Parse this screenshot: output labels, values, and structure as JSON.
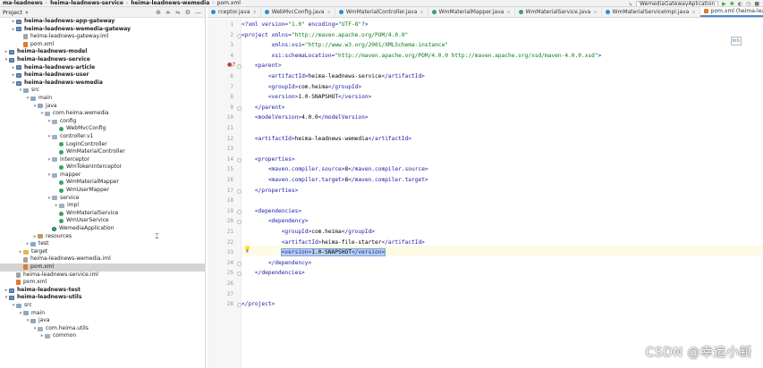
{
  "breadcrumbs": [
    "ma-leadnews",
    "heima-leadnews-service",
    "heima-leadnews-wemedia",
    "pom.xml"
  ],
  "run_config": "WemediaGatewayAplication",
  "project": {
    "title": "Project",
    "tree": [
      {
        "label": "heima-leadnews-app-gateway",
        "indent": 1,
        "icon": "module",
        "arrow": "▸",
        "bold": true
      },
      {
        "label": "heima-leadnews-wemedia-gateway",
        "indent": 1,
        "icon": "module",
        "arrow": "▸",
        "bold": true
      },
      {
        "label": "heima-leadnews-gateway.iml",
        "indent": 2,
        "icon": "iml",
        "arrow": "",
        "bold": false
      },
      {
        "label": "pom.xml",
        "indent": 2,
        "icon": "xml",
        "arrow": "",
        "bold": false
      },
      {
        "label": "heima-leadnews-model",
        "indent": 0,
        "icon": "module",
        "arrow": "▸",
        "bold": true
      },
      {
        "label": "heima-leadnews-service",
        "indent": 0,
        "icon": "module",
        "arrow": "▾",
        "bold": true
      },
      {
        "label": "heima-leadnews-article",
        "indent": 1,
        "icon": "module",
        "arrow": "▸",
        "bold": true
      },
      {
        "label": "heima-leadnews-user",
        "indent": 1,
        "icon": "module",
        "arrow": "▸",
        "bold": true
      },
      {
        "label": "heima-leadnews-wemedia",
        "indent": 1,
        "icon": "module",
        "arrow": "▾",
        "bold": true
      },
      {
        "label": "src",
        "indent": 2,
        "icon": "folder",
        "arrow": "▾",
        "bold": false
      },
      {
        "label": "main",
        "indent": 3,
        "icon": "folder",
        "arrow": "▾",
        "bold": false
      },
      {
        "label": "java",
        "indent": 4,
        "icon": "folder",
        "arrow": "▾",
        "bold": false
      },
      {
        "label": "com.heima.wemedia",
        "indent": 5,
        "icon": "pkg",
        "arrow": "▾",
        "bold": false
      },
      {
        "label": "config",
        "indent": 6,
        "icon": "pkg",
        "arrow": "▾",
        "bold": false
      },
      {
        "label": "WebMvcConfig",
        "indent": 7,
        "icon": "java",
        "arrow": "",
        "bold": false
      },
      {
        "label": "controller.v1",
        "indent": 6,
        "icon": "pkg",
        "arrow": "▾",
        "bold": false
      },
      {
        "label": "LoginController",
        "indent": 7,
        "icon": "java",
        "arrow": "",
        "bold": false
      },
      {
        "label": "WmMaterialController",
        "indent": 7,
        "icon": "java",
        "arrow": "",
        "bold": false
      },
      {
        "label": "interceptor",
        "indent": 6,
        "icon": "pkg",
        "arrow": "▾",
        "bold": false
      },
      {
        "label": "WmTokenInterceptor",
        "indent": 7,
        "icon": "java",
        "arrow": "",
        "bold": false
      },
      {
        "label": "mapper",
        "indent": 6,
        "icon": "pkg",
        "arrow": "▾",
        "bold": false
      },
      {
        "label": "WmMaterialMapper",
        "indent": 7,
        "icon": "java",
        "arrow": "",
        "bold": false
      },
      {
        "label": "WmUserMapper",
        "indent": 7,
        "icon": "java",
        "arrow": "",
        "bold": false
      },
      {
        "label": "service",
        "indent": 6,
        "icon": "pkg",
        "arrow": "▾",
        "bold": false
      },
      {
        "label": "impl",
        "indent": 7,
        "icon": "pkg",
        "arrow": "▸",
        "bold": false
      },
      {
        "label": "WmMaterialService",
        "indent": 7,
        "icon": "java",
        "arrow": "",
        "bold": false
      },
      {
        "label": "WmUserService",
        "indent": 7,
        "icon": "java",
        "arrow": "",
        "bold": false
      },
      {
        "label": "WemediaApplication",
        "indent": 6,
        "icon": "app",
        "arrow": "",
        "bold": false
      },
      {
        "label": "resources",
        "indent": 4,
        "icon": "res",
        "arrow": "▸",
        "bold": false
      },
      {
        "label": "test",
        "indent": 3,
        "icon": "folder",
        "arrow": "▸",
        "bold": false
      },
      {
        "label": "target",
        "indent": 2,
        "icon": "folder-y",
        "arrow": "▸",
        "bold": false
      },
      {
        "label": "heima-leadnews-wemedia.iml",
        "indent": 2,
        "icon": "iml",
        "arrow": "",
        "bold": false
      },
      {
        "label": "pom.xml",
        "indent": 2,
        "icon": "xml",
        "arrow": "",
        "bold": false,
        "selected": true
      },
      {
        "label": "heima-leadnews-service.iml",
        "indent": 1,
        "icon": "iml",
        "arrow": "",
        "bold": false
      },
      {
        "label": "pom.xml",
        "indent": 1,
        "icon": "xml",
        "arrow": "",
        "bold": false
      },
      {
        "label": "heima-leadnews-test",
        "indent": 0,
        "icon": "module",
        "arrow": "▸",
        "bold": true
      },
      {
        "label": "heima-leadnews-utils",
        "indent": 0,
        "icon": "module",
        "arrow": "▾",
        "bold": true
      },
      {
        "label": "src",
        "indent": 1,
        "icon": "folder",
        "arrow": "▾",
        "bold": false
      },
      {
        "label": "main",
        "indent": 2,
        "icon": "folder",
        "arrow": "▾",
        "bold": false
      },
      {
        "label": "java",
        "indent": 3,
        "icon": "folder",
        "arrow": "▾",
        "bold": false
      },
      {
        "label": "com.heima.utils",
        "indent": 4,
        "icon": "pkg",
        "arrow": "▾",
        "bold": false
      },
      {
        "label": "common",
        "indent": 5,
        "icon": "pkg",
        "arrow": "▸",
        "bold": false
      }
    ]
  },
  "tabs": [
    {
      "label": "rceptor.java",
      "icon": "c",
      "active": false
    },
    {
      "label": "WebMvcConfig.java",
      "icon": "c",
      "active": false
    },
    {
      "label": "WmMaterialController.java",
      "icon": "c",
      "active": false
    },
    {
      "label": "WmMaterialMapper.java",
      "icon": "g",
      "active": false
    },
    {
      "label": "WmMaterialService.java",
      "icon": "g",
      "active": false
    },
    {
      "label": "WmMaterialServiceImpl.java",
      "icon": "c",
      "active": false
    },
    {
      "label": "pom.xml (heima-leadnews-wemedia)",
      "icon": "m",
      "active": true
    }
  ],
  "editor": {
    "lines": [
      {
        "n": "1",
        "html": "<span class=\"tag\">&lt;?xml </span><span class=\"attr\">version=</span><span class=\"val\">\"1.0\"</span><span class=\"attr\"> encoding=</span><span class=\"val\">\"UTF-8\"</span><span class=\"tag\">?&gt;</span>",
        "fold": false
      },
      {
        "n": "2",
        "html": "<span class=\"tag\">&lt;project </span><span class=\"attr\">xmlns=</span><span class=\"val\">\"http://maven.apache.org/POM/4.0.0\"</span>",
        "fold": true
      },
      {
        "n": "3",
        "html": "         <span class=\"attr\">xmlns:xsi=</span><span class=\"val\">\"http://www.w3.org/2001/XMLSchema-instance\"</span>",
        "fold": false
      },
      {
        "n": "4",
        "html": "         <span class=\"attr\">xsi:schemaLocation=</span><span class=\"val\">\"http://maven.apache.org/POM/4.0.0 http://maven.apache.org/xsd/maven-4.0.0.xsd\"</span><span class=\"tag\">&gt;</span>",
        "fold": false
      },
      {
        "n": "5",
        "html": "    <span class=\"tag\">&lt;parent&gt;</span>",
        "fold": true
      },
      {
        "n": "6",
        "html": "        <span class=\"tag\">&lt;artifactId&gt;</span>heima-leadnews-service<span class=\"tag\">&lt;/artifactId&gt;</span>",
        "fold": false
      },
      {
        "n": "7",
        "html": "        <span class=\"tag\">&lt;groupId&gt;</span>com.heima<span class=\"tag\">&lt;/groupId&gt;</span>",
        "fold": false
      },
      {
        "n": "8",
        "html": "        <span class=\"tag\">&lt;version&gt;</span>1.0-SNAPSHOT<span class=\"tag\">&lt;/version&gt;</span>",
        "fold": false
      },
      {
        "n": "9",
        "html": "    <span class=\"tag\">&lt;/parent&gt;</span>",
        "fold": true
      },
      {
        "n": "10",
        "html": "    <span class=\"tag\">&lt;modelVersion&gt;</span>4.0.0<span class=\"tag\">&lt;/modelVersion&gt;</span>",
        "fold": false
      },
      {
        "n": "11",
        "html": "",
        "fold": false
      },
      {
        "n": "12",
        "html": "    <span class=\"tag\">&lt;artifactId&gt;</span>heima-leadnews-wemedia<span class=\"tag\">&lt;/artifactId&gt;</span>",
        "fold": false
      },
      {
        "n": "13",
        "html": "",
        "fold": false
      },
      {
        "n": "14",
        "html": "    <span class=\"tag\">&lt;properties&gt;</span>",
        "fold": true
      },
      {
        "n": "15",
        "html": "        <span class=\"tag\">&lt;maven.compiler.source&gt;</span>8<span class=\"tag\">&lt;/maven.compiler.source&gt;</span>",
        "fold": false
      },
      {
        "n": "16",
        "html": "        <span class=\"tag\">&lt;maven.compiler.target&gt;</span>8<span class=\"tag\">&lt;/maven.compiler.target&gt;</span>",
        "fold": false
      },
      {
        "n": "17",
        "html": "    <span class=\"tag\">&lt;/properties&gt;</span>",
        "fold": true
      },
      {
        "n": "18",
        "html": "",
        "fold": false
      },
      {
        "n": "19",
        "html": "    <span class=\"tag\">&lt;dependencies&gt;</span>",
        "fold": true
      },
      {
        "n": "20",
        "html": "        <span class=\"tag\">&lt;dependency&gt;</span>",
        "fold": true
      },
      {
        "n": "21",
        "html": "            <span class=\"tag\">&lt;groupId&gt;</span>com.heima<span class=\"tag\">&lt;/groupId&gt;</span>",
        "fold": false
      },
      {
        "n": "22",
        "html": "            <span class=\"tag\">&lt;artifactId&gt;</span>heima-file-starter<span class=\"tag\">&lt;/artifactId&gt;</span>",
        "fold": false
      },
      {
        "n": "23",
        "html": "            <span class=\"sel\"><span class=\"tag\">&lt;version&gt;</span>1.0-SNAPSHOT<span class=\"tag\">&lt;/version&gt;</span></span>",
        "fold": false
      },
      {
        "n": "24",
        "html": "        <span class=\"tag\">&lt;/dependency&gt;</span>",
        "fold": true
      },
      {
        "n": "25",
        "html": "    <span class=\"tag\">&lt;/dependencies&gt;</span>",
        "fold": true
      },
      {
        "n": "26",
        "html": "",
        "fold": false
      },
      {
        "n": "27",
        "html": "",
        "fold": false
      },
      {
        "n": "28",
        "html": "<span class=\"tag\">&lt;/project&gt;</span>",
        "fold": true
      }
    ]
  },
  "watermark": "CSDN @幸运小新"
}
